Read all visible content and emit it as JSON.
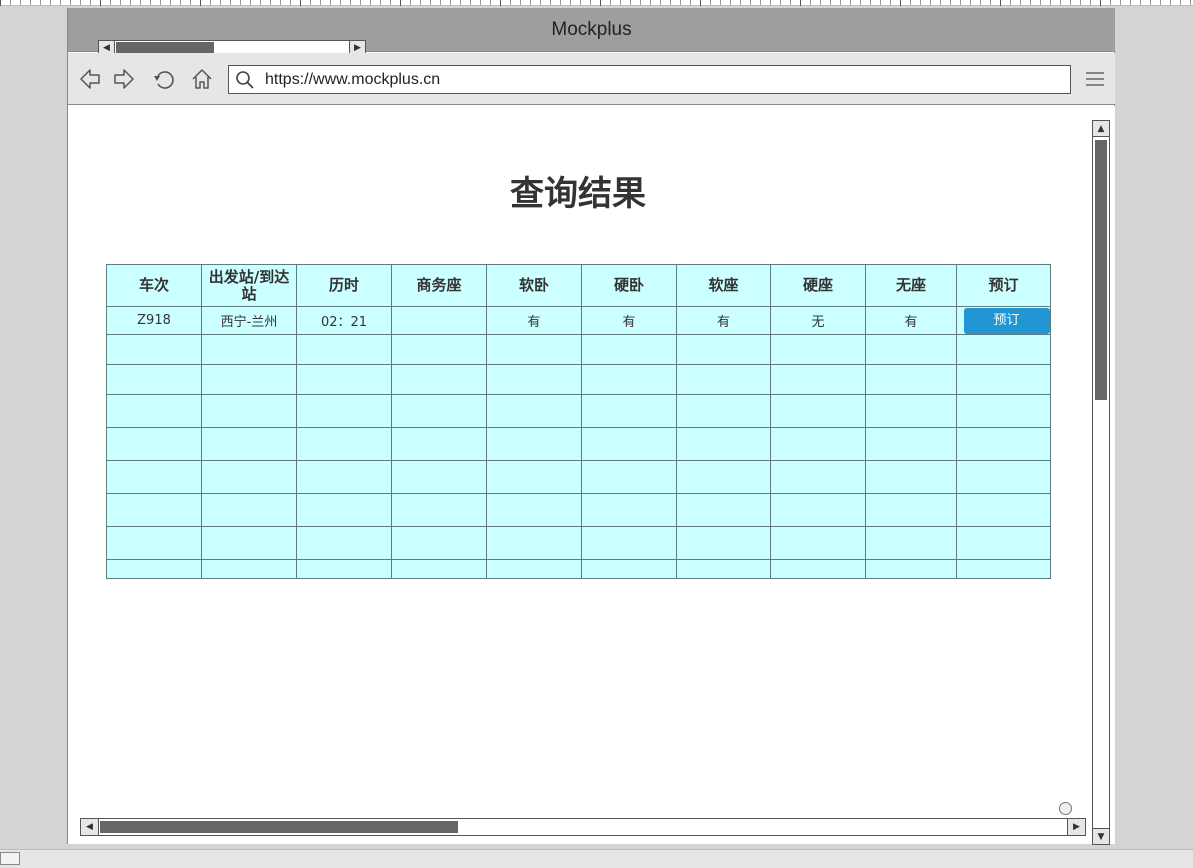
{
  "window": {
    "title": "Mockplus"
  },
  "navbar": {
    "url": "https://www.mockplus.cn",
    "icons": [
      "back-icon",
      "forward-icon",
      "refresh-icon",
      "home-icon",
      "search-icon",
      "menu-icon"
    ]
  },
  "page": {
    "heading": "查询结果"
  },
  "table": {
    "headers": [
      "车次",
      "出发站/到达站",
      "历时",
      "商务座",
      "软卧",
      "硬卧",
      "软座",
      "硬座",
      "无座",
      "预订"
    ],
    "rows": [
      {
        "train": "Z918",
        "stations": "西宁-兰州",
        "duration": "02：21",
        "business": "",
        "soft_sleeper": "有",
        "hard_sleeper": "有",
        "soft_seat": "有",
        "hard_seat": "无",
        "no_seat": "有",
        "book_label": "预订"
      }
    ]
  },
  "colors": {
    "accent": "#2196d3",
    "table_fill": "#ccffff",
    "titlebar": "#9e9e9e"
  }
}
